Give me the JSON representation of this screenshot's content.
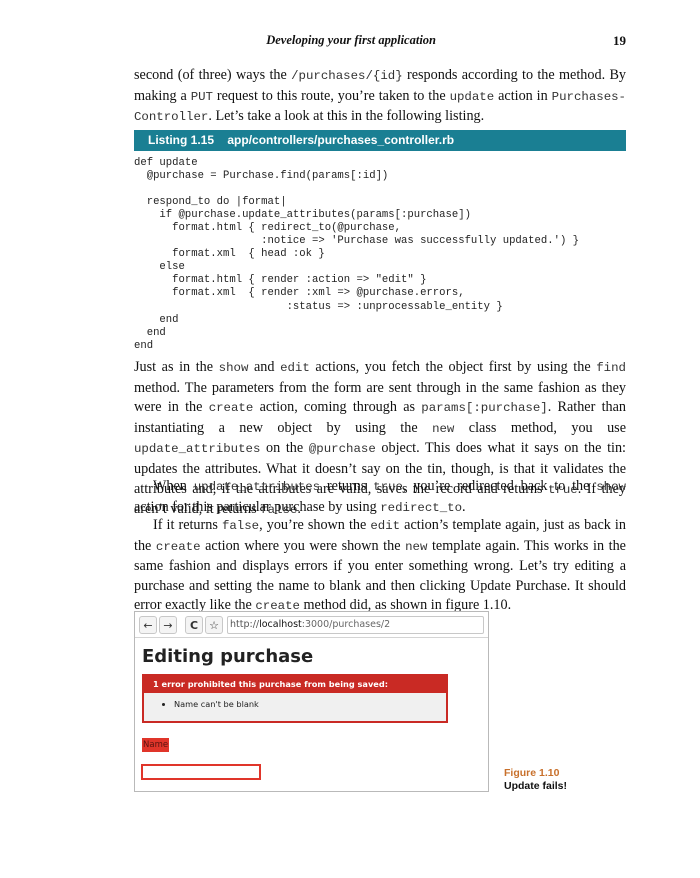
{
  "header": {
    "title": "Developing your first application",
    "page_number": "19"
  },
  "intro": {
    "t1": "second (of three) ways the ",
    "c1": "/purchases/{id}",
    "t2": " responds according to the method. By making a ",
    "c2": "PUT",
    "t3": " request to this route, you’re taken to the ",
    "c3": "update",
    "t4": " action in ",
    "c4": "Purchases-Controller",
    "t5": ". Let’s take a look at this in the following listing."
  },
  "listing": {
    "number": "Listing 1.15",
    "file": "app/controllers/purchases_controller.rb"
  },
  "code": "def update\n  @purchase = Purchase.find(params[:id])\n\n  respond_to do |format|\n    if @purchase.update_attributes(params[:purchase])\n      format.html { redirect_to(@purchase,\n                    :notice => 'Purchase was successfully updated.') }\n      format.xml  { head :ok }\n    else\n      format.html { render :action => \"edit\" }\n      format.xml  { render :xml => @purchase.errors,\n                        :status => :unprocessable_entity }\n    end\n  end\nend",
  "p1": {
    "t1": "Just as in the ",
    "c1": "show",
    "t2": " and ",
    "c2": "edit",
    "t3": " actions, you fetch the object first by using the ",
    "c3": "find",
    "t4": " method. The parameters from the form are sent through in the same fashion as they were in the ",
    "c4": "create",
    "t5": " action, coming through as ",
    "c5": "params[:purchase]",
    "t6": ". Rather than instantiating a new object by using the ",
    "c6": "new",
    "t7": " class method, you use ",
    "c7": "update_attributes",
    "t8": " on the ",
    "c8": "@purchase",
    "t9": " object. This does what it says on the tin: updates the attributes. What it doesn’t say on the tin, though, is that it validates the attributes and, if the attributes are valid, saves the record and returns ",
    "c9": "true",
    "t10": ". If they aren’t valid, it returns ",
    "c10": "false",
    "t11": "."
  },
  "p2": {
    "t1": "When ",
    "c1": "update_attributes",
    "t2": " returns ",
    "c2": "true",
    "t3": ", you’re redirected back to the ",
    "c3": "show",
    "t4": " action for this particular purchase by using ",
    "c4": "redirect_to",
    "t5": "."
  },
  "p3": {
    "t1": "If it returns ",
    "c1": "false",
    "t2": ", you’re shown the ",
    "c2": "edit",
    "t3": " action’s template again, just as back in the ",
    "c3": "create",
    "t4": " action where you were shown the ",
    "c4": "new",
    "t5": " template again. This works in the same fashion and displays errors if you enter something wrong. Let’s try editing a purchase and setting the name to blank and then clicking Update Purchase. It should error exactly like the ",
    "c5": "create",
    "t6": " method did, as shown in figure 1.10."
  },
  "figure": {
    "back_icon": "←",
    "forward_icon": "→",
    "reload_icon": "C",
    "star_icon": "☆",
    "url_prefix": "http://",
    "url_host": "localhost",
    "url_rest": ":3000/purchases/2",
    "heading": "Editing purchase",
    "error_header": "1 error prohibited this purchase from being saved:",
    "errors": [
      "Name can't be blank"
    ],
    "field_label": "Name",
    "field_value": ""
  },
  "caption": {
    "number": "Figure 1.10",
    "text": "Update fails!"
  }
}
